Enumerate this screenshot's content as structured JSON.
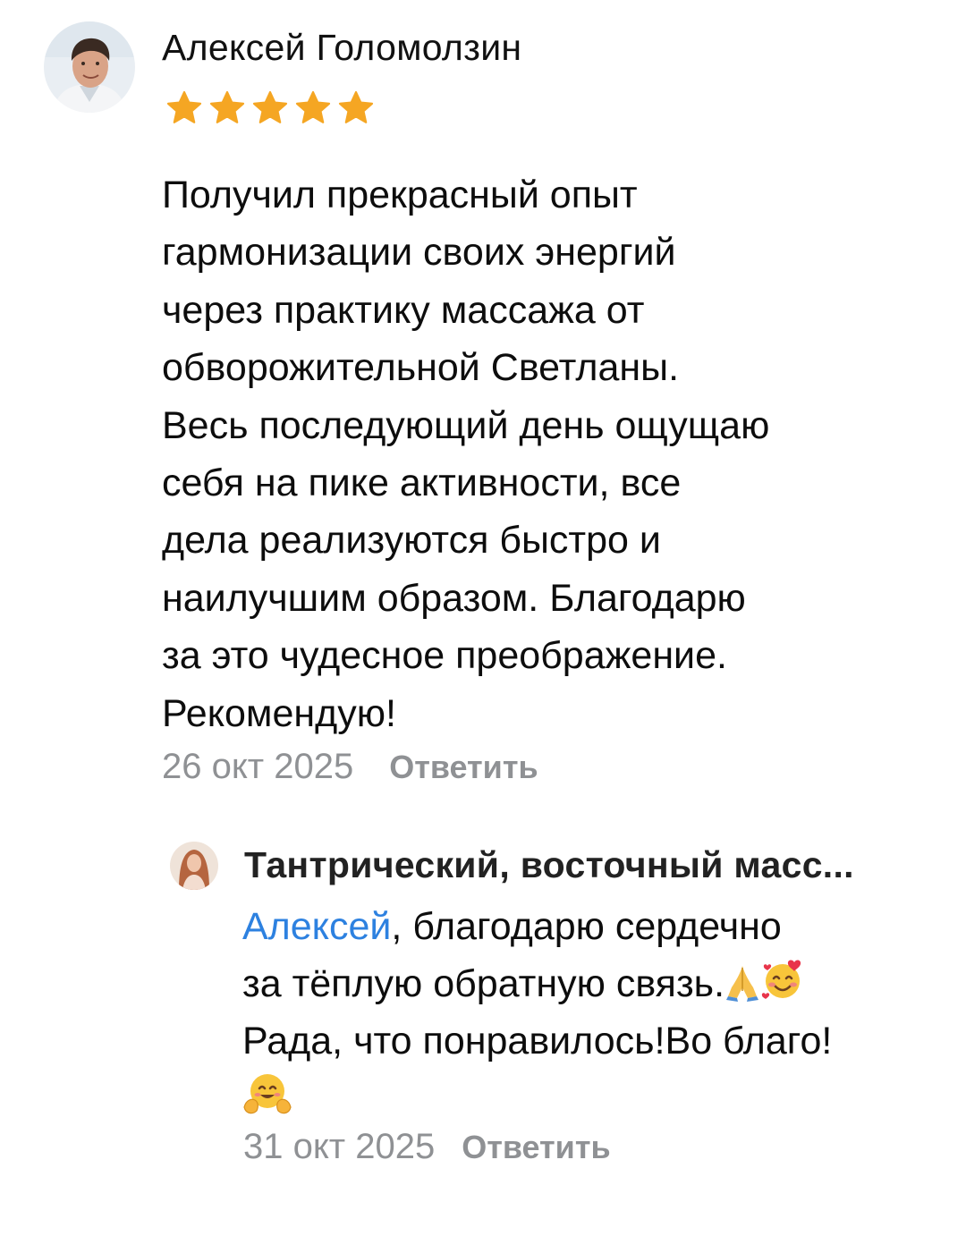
{
  "review": {
    "author": "Алексей Голомолзин",
    "rating": 5,
    "max_rating": 5,
    "text_lines": [
      "Получил прекрасный опыт",
      "гармонизации своих энергий",
      "через практику массажа от",
      "обворожительной Светланы.",
      "Весь последующий день ощущаю",
      "себя на пике активности, все",
      "дела реализуются быстро и",
      "наилучшим образом. Благодарю",
      "за это чудесное преображение.",
      "Рекомендую!"
    ],
    "date": "26 окт 2025",
    "reply_label": "Ответить"
  },
  "reply": {
    "author": "Тантрический, восточный масс...",
    "mention": "Алексей",
    "line1_rest": ",  благодарю сердечно",
    "line2": "за тёплую обратную связь.",
    "line3": "Рада, что понравилось!Во благо!",
    "emojis": [
      "folded-hands",
      "smiling-face-with-hearts",
      "hugging-face"
    ],
    "date": "31 окт 2025",
    "reply_label": "Ответить"
  },
  "colors": {
    "star": "#f5a623",
    "mention": "#2d81e0",
    "muted": "#8f9194"
  }
}
